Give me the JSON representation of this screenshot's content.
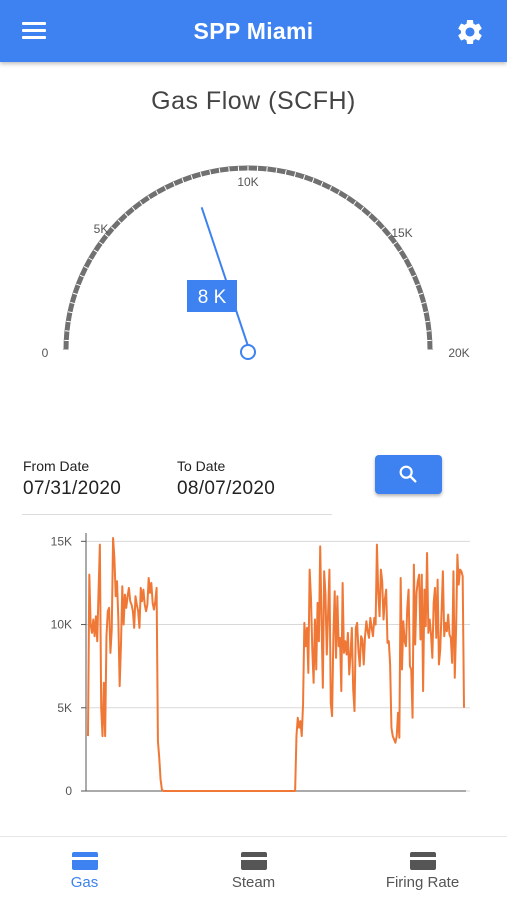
{
  "app_bar": {
    "title": "SPP Miami",
    "menu_icon": "hamburger-menu-icon",
    "settings_icon": "gear-icon",
    "color": "#3d82f0"
  },
  "gauge": {
    "title": "Gas Flow (SCFH)",
    "value": 8000,
    "value_label": "8 K",
    "min": 0,
    "max": 20000,
    "scale_labels": [
      "0",
      "5K",
      "10K",
      "15K",
      "20K"
    ],
    "needle_color": "#3d82f0",
    "arc_color": "#707070"
  },
  "filters": {
    "from_label": "From Date",
    "from_value": "07/31/2020",
    "to_label": "To Date",
    "to_value": "08/07/2020",
    "search_icon": "search-icon"
  },
  "chart_data": {
    "type": "line",
    "ylim": [
      0,
      15500
    ],
    "yticks": [
      0,
      5000,
      10000,
      15000
    ],
    "ytick_labels": [
      "0",
      "5K",
      "10K",
      "15K"
    ],
    "color": "#f07836",
    "grid": true,
    "values": [
      3300,
      13000,
      10000,
      9500,
      10300,
      9300,
      10500,
      9000,
      12000,
      14800,
      5000,
      3300,
      6500,
      3300,
      9300,
      10800,
      11000,
      8300,
      9700,
      15200,
      14000,
      11700,
      12600,
      10300,
      6300,
      8800,
      12300,
      10000,
      11800,
      11000,
      11700,
      12200,
      11400,
      11200,
      10800,
      9800,
      11700,
      11200,
      10800,
      9800,
      12200,
      11400,
      12100,
      11200,
      10800,
      11200,
      12800,
      11900,
      12500,
      11300,
      10900,
      11400,
      12200,
      3000,
      2000,
      700,
      100,
      0,
      0,
      0,
      0,
      0,
      0,
      0,
      0,
      0,
      0,
      0,
      0,
      0,
      0,
      0,
      0,
      0,
      0,
      0,
      0,
      0,
      0,
      0,
      0,
      0,
      0,
      0,
      0,
      0,
      0,
      0,
      0,
      0,
      0,
      0,
      0,
      0,
      0,
      0,
      0,
      0,
      0,
      0,
      0,
      0,
      0,
      0,
      0,
      0,
      0,
      0,
      0,
      0,
      0,
      0,
      0,
      0,
      0,
      0,
      0,
      0,
      0,
      0,
      0,
      0,
      0,
      0,
      0,
      0,
      0,
      0,
      0,
      0,
      0,
      0,
      0,
      0,
      0,
      0,
      0,
      0,
      0,
      0,
      0,
      0,
      0,
      0,
      0,
      0,
      0,
      0,
      0,
      0,
      0,
      0,
      0,
      0,
      0,
      0,
      0,
      0,
      3300,
      4400,
      3800,
      4200,
      3300,
      5200,
      10100,
      8700,
      9800,
      7100,
      13300,
      11600,
      8500,
      6500,
      10300,
      7300,
      11300,
      9000,
      14700,
      10300,
      6200,
      13200,
      11800,
      8200,
      10700,
      13300,
      5300,
      4500,
      9300,
      12000,
      8000,
      11700,
      8700,
      9200,
      6000,
      12500,
      8300,
      9000,
      8200,
      9500,
      7000,
      8200,
      9800,
      6100,
      4800,
      9800,
      10100,
      8400,
      7500,
      9300,
      9100,
      7600,
      9300,
      10200,
      9600,
      9200,
      10400,
      9800,
      9300,
      10400,
      10000,
      14800,
      11900,
      10500,
      13300,
      12600,
      10300,
      11500,
      12100,
      8900,
      9000,
      7600,
      3800,
      3300,
      3100,
      2900,
      3300,
      4700,
      3200,
      12800,
      7300,
      10200,
      9000,
      8700,
      11000,
      12100,
      7500,
      7300,
      4400,
      13600,
      8800,
      11900,
      12600,
      13000,
      9100,
      13000,
      6000,
      12100,
      9900,
      14300,
      9500,
      10300,
      9400,
      8000,
      11300,
      12200,
      9200,
      12700,
      7600,
      8500,
      10800,
      13200,
      9300,
      10100,
      9600,
      10600,
      9400,
      9200,
      7700,
      13200,
      6800,
      9700,
      14200,
      12400,
      13300,
      13200,
      12900,
      5000
    ]
  },
  "bottom_nav": {
    "items": [
      {
        "label": "Gas",
        "icon": "card-icon",
        "active": true
      },
      {
        "label": "Steam",
        "icon": "card-icon",
        "active": false
      },
      {
        "label": "Firing Rate",
        "icon": "card-icon",
        "active": false
      }
    ],
    "active_color": "#3d82f0",
    "inactive_color": "#555555"
  }
}
